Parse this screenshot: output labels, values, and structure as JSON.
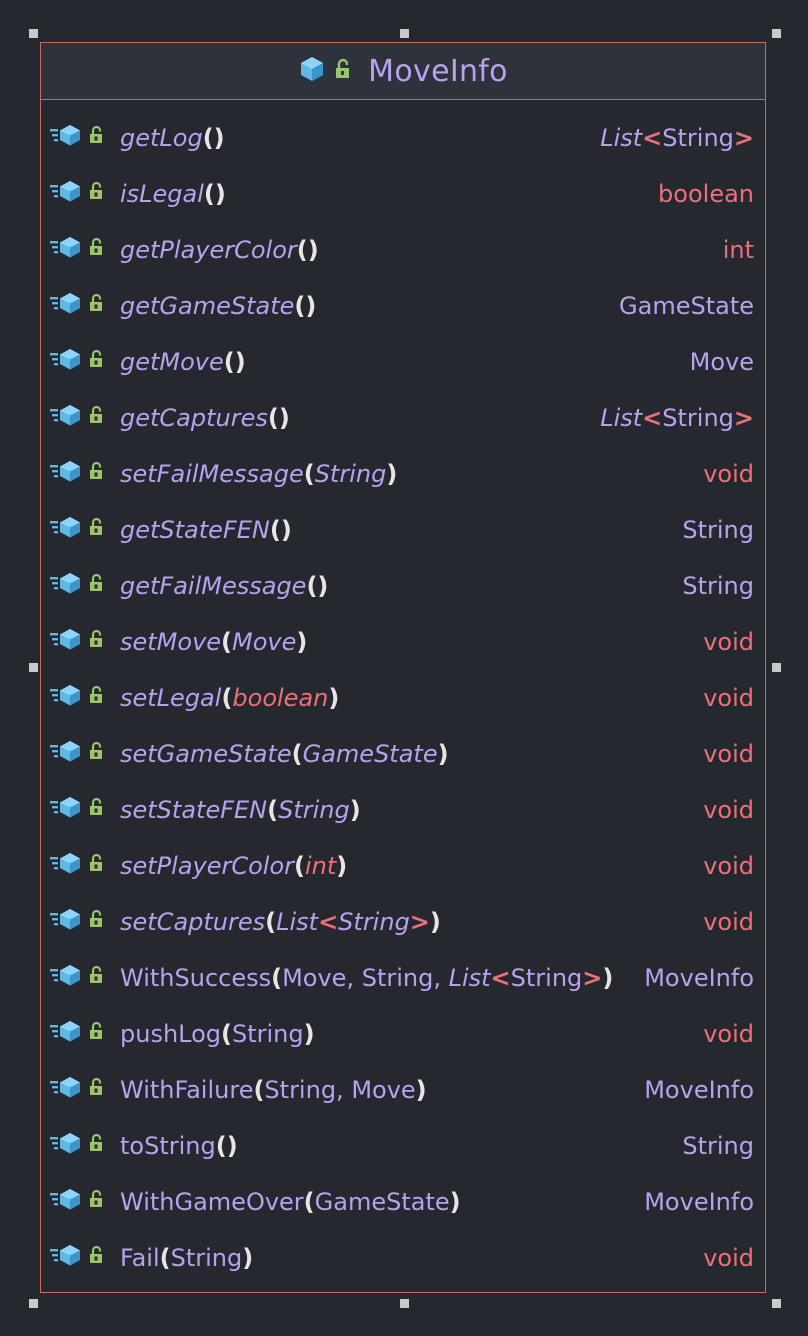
{
  "class": {
    "name": "MoveInfo",
    "icon": "class-cube-icon",
    "visibility_icon": "public-lock-icon"
  },
  "methods": [
    {
      "italic": true,
      "name": "getLog",
      "params": [],
      "ret": [
        {
          "t": "List",
          "i": true
        },
        {
          "t": "<",
          "k": "lt"
        },
        {
          "t": "String"
        },
        {
          "t": ">",
          "k": "lt"
        }
      ]
    },
    {
      "italic": true,
      "name": "isLegal",
      "params": [],
      "ret": [
        {
          "t": "boolean",
          "k": "red"
        }
      ]
    },
    {
      "italic": true,
      "name": "getPlayerColor",
      "params": [],
      "ret": [
        {
          "t": "int",
          "k": "red"
        }
      ]
    },
    {
      "italic": true,
      "name": "getGameState",
      "params": [],
      "ret": [
        {
          "t": "GameState"
        }
      ]
    },
    {
      "italic": true,
      "name": "getMove",
      "params": [],
      "ret": [
        {
          "t": "Move"
        }
      ]
    },
    {
      "italic": true,
      "name": "getCaptures",
      "params": [],
      "ret": [
        {
          "t": "List",
          "i": true
        },
        {
          "t": "<",
          "k": "lt"
        },
        {
          "t": "String"
        },
        {
          "t": ">",
          "k": "lt"
        }
      ]
    },
    {
      "italic": true,
      "name": "setFailMessage",
      "params": [
        [
          {
            "t": "String"
          }
        ]
      ],
      "ret": [
        {
          "t": "void",
          "k": "red"
        }
      ]
    },
    {
      "italic": true,
      "name": "getStateFEN",
      "params": [],
      "ret": [
        {
          "t": "String"
        }
      ]
    },
    {
      "italic": true,
      "name": "getFailMessage",
      "params": [],
      "ret": [
        {
          "t": "String"
        }
      ]
    },
    {
      "italic": true,
      "name": "setMove",
      "params": [
        [
          {
            "t": "Move"
          }
        ]
      ],
      "ret": [
        {
          "t": "void",
          "k": "red"
        }
      ]
    },
    {
      "italic": true,
      "name": "setLegal",
      "params": [
        [
          {
            "t": "boolean",
            "k": "red"
          }
        ]
      ],
      "ret": [
        {
          "t": "void",
          "k": "red"
        }
      ]
    },
    {
      "italic": true,
      "name": "setGameState",
      "params": [
        [
          {
            "t": "GameState"
          }
        ]
      ],
      "ret": [
        {
          "t": "void",
          "k": "red"
        }
      ]
    },
    {
      "italic": true,
      "name": "setStateFEN",
      "params": [
        [
          {
            "t": "String"
          }
        ]
      ],
      "ret": [
        {
          "t": "void",
          "k": "red"
        }
      ]
    },
    {
      "italic": true,
      "name": "setPlayerColor",
      "params": [
        [
          {
            "t": "int",
            "k": "red"
          }
        ]
      ],
      "ret": [
        {
          "t": "void",
          "k": "red"
        }
      ]
    },
    {
      "italic": true,
      "name": "setCaptures",
      "params": [
        [
          {
            "t": "List"
          },
          {
            "t": "<",
            "k": "lt"
          },
          {
            "t": "String"
          },
          {
            "t": ">",
            "k": "lt"
          }
        ]
      ],
      "ret": [
        {
          "t": "void",
          "k": "red"
        }
      ]
    },
    {
      "italic": false,
      "name": "WithSuccess",
      "params": [
        [
          {
            "t": "Move"
          }
        ],
        [
          {
            "t": "String"
          }
        ],
        [
          {
            "t": "List",
            "i": true
          },
          {
            "t": "<",
            "k": "lt"
          },
          {
            "t": "String"
          },
          {
            "t": ">",
            "k": "lt"
          }
        ]
      ],
      "ret": [
        {
          "t": "MoveInfo"
        }
      ]
    },
    {
      "italic": false,
      "name": "pushLog",
      "params": [
        [
          {
            "t": "String"
          }
        ]
      ],
      "ret": [
        {
          "t": "void",
          "k": "red"
        }
      ]
    },
    {
      "italic": false,
      "name": "WithFailure",
      "params": [
        [
          {
            "t": "String"
          }
        ],
        [
          {
            "t": "Move"
          }
        ]
      ],
      "ret": [
        {
          "t": "MoveInfo"
        }
      ]
    },
    {
      "italic": false,
      "name": "toString",
      "params": [],
      "ret": [
        {
          "t": "String"
        }
      ]
    },
    {
      "italic": false,
      "name": "WithGameOver",
      "params": [
        [
          {
            "t": "GameState"
          }
        ]
      ],
      "ret": [
        {
          "t": "MoveInfo"
        }
      ]
    },
    {
      "italic": false,
      "name": "Fail",
      "params": [
        [
          {
            "t": "String"
          }
        ]
      ],
      "ret": [
        {
          "t": "void",
          "k": "red"
        }
      ]
    }
  ],
  "row_icons": [
    "method-icon",
    "public-lock-icon"
  ],
  "colors": {
    "background": "#25282e",
    "header": "#2d323b",
    "border": "#c86a5e",
    "name": "#b8a2f0",
    "keyword": "#ec6f78",
    "cube": "#5fb8e8",
    "lock": "#9bc46d"
  }
}
